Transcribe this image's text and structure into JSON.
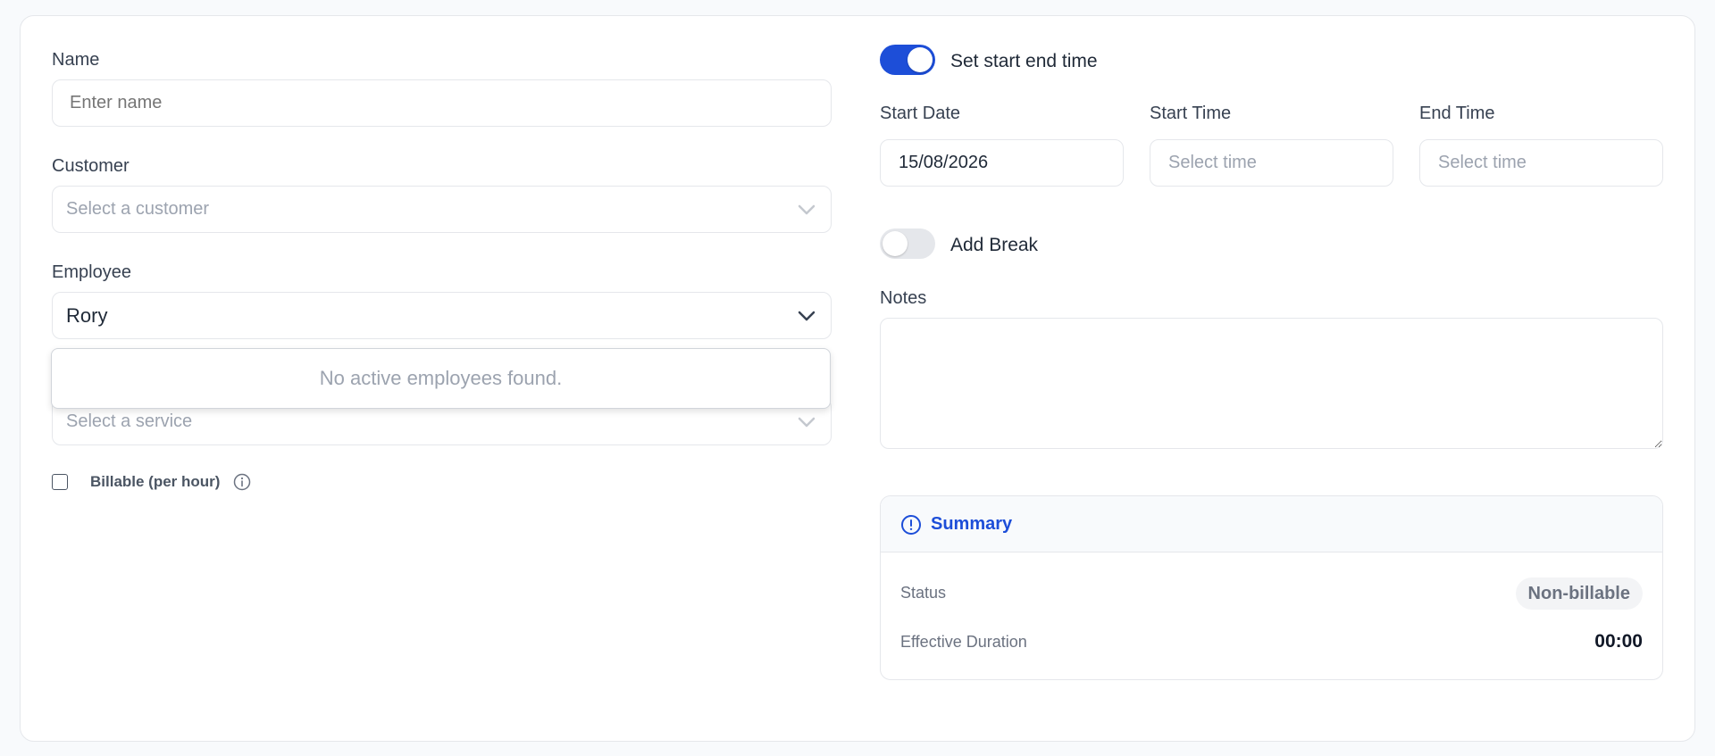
{
  "form": {
    "name": {
      "label": "Name",
      "placeholder": "Enter name"
    },
    "customer": {
      "label": "Customer",
      "placeholder": "Select a customer"
    },
    "employee": {
      "label": "Employee",
      "value": "Rory",
      "dropdown_message": "No active employees found."
    },
    "service": {
      "placeholder": "Select a service"
    },
    "billable": {
      "label": "Billable (per hour)",
      "checked": false
    },
    "set_start_end": {
      "label": "Set start end time",
      "on": true
    },
    "start_date": {
      "label": "Start Date",
      "value": "15/08/2026"
    },
    "start_time": {
      "label": "Start Time",
      "placeholder": "Select time"
    },
    "end_time": {
      "label": "End Time",
      "placeholder": "Select time"
    },
    "add_break": {
      "label": "Add Break",
      "on": false
    },
    "notes": {
      "label": "Notes",
      "value": ""
    }
  },
  "summary": {
    "title": "Summary",
    "status_label": "Status",
    "status_value": "Non-billable",
    "duration_label": "Effective Duration",
    "duration_value": "00:00"
  },
  "colors": {
    "accent": "#1d4ed8",
    "toggle_on": "#1d4ed8",
    "toggle_off": "#e5e7eb"
  },
  "icons": {
    "info": "info-icon",
    "summary": "alert-circle-icon",
    "chevron": "chevron-down-icon"
  }
}
